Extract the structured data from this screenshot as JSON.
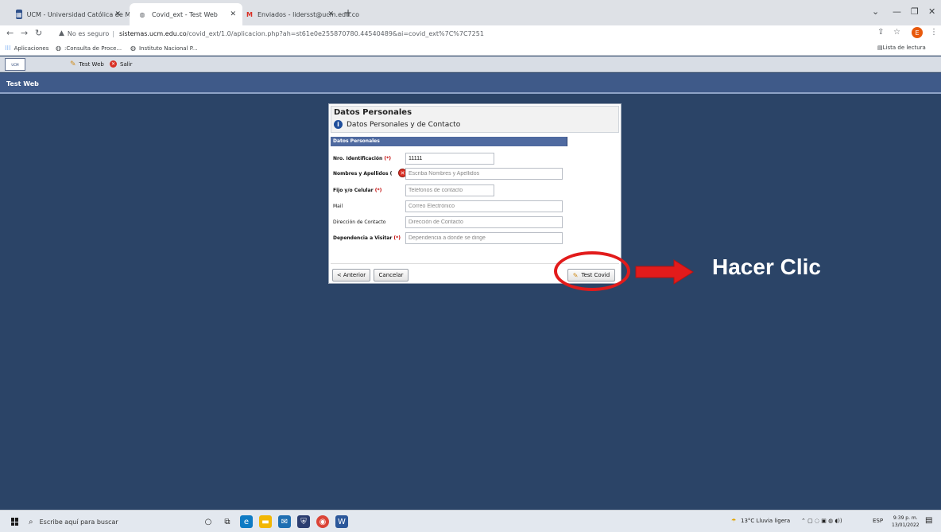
{
  "browser": {
    "tabs": [
      {
        "label": "UCM - Universidad Católica de M",
        "active": false
      },
      {
        "label": "Covid_ext - Test Web",
        "active": true
      },
      {
        "label": "Enviados - lidersst@ucm.edu.co",
        "active": false
      }
    ],
    "new_tab": "+",
    "address": {
      "security": "No es seguro",
      "host": "sistemas.ucm.edu.co",
      "path": "/covid_ext/1.0/aplicacion.php?ah=st61e0e255870780.44540489&ai=covid_ext%7C%7C7251"
    },
    "profile_initial": "E",
    "bookmarks": [
      {
        "label": "Aplicaciones"
      },
      {
        "label": ":Consulta de Proce..."
      },
      {
        "label": "Instituto Nacional P..."
      }
    ],
    "reading_list": "Lista de lectura"
  },
  "app": {
    "menu": {
      "test_web": "Test Web",
      "salir": "Salir"
    },
    "title": "Test Web",
    "form": {
      "header_title": "Datos Personales",
      "header_subtitle": "Datos Personales y de Contacto",
      "section": "Datos Personales",
      "fields": [
        {
          "label": "Nro. Identificación",
          "req": "(*)",
          "value": "11111",
          "placeholder": ""
        },
        {
          "label": "Nombres y Apellidos (",
          "req": "",
          "value": "",
          "placeholder": "Escriba Nombres y Apellidos"
        },
        {
          "label": "Fijo y/o Celular",
          "req": "(*)",
          "value": "",
          "placeholder": "Teléfonos de contacto"
        },
        {
          "label": "Mail",
          "req": "",
          "value": "",
          "placeholder": "Correo Electrónico"
        },
        {
          "label": "Dirección de Contacto",
          "req": "",
          "value": "",
          "placeholder": "Dirección de Contacto"
        },
        {
          "label": "Dependencia a Visitar",
          "req": "(*)",
          "value": "",
          "placeholder": "Dependencia a donde se dirige"
        }
      ],
      "buttons": {
        "anterior": "< Anterior",
        "cancelar": "Cancelar",
        "test_covid": "Test Covid"
      }
    }
  },
  "annotation": {
    "text": "Hacer Clic",
    "color": "#e21b1b"
  },
  "taskbar": {
    "search_placeholder": "Escribe aquí para buscar",
    "weather": "13°C Lluvia ligera",
    "lang": "ESP",
    "time": "9:39 p. m.",
    "date": "13/01/2022"
  }
}
